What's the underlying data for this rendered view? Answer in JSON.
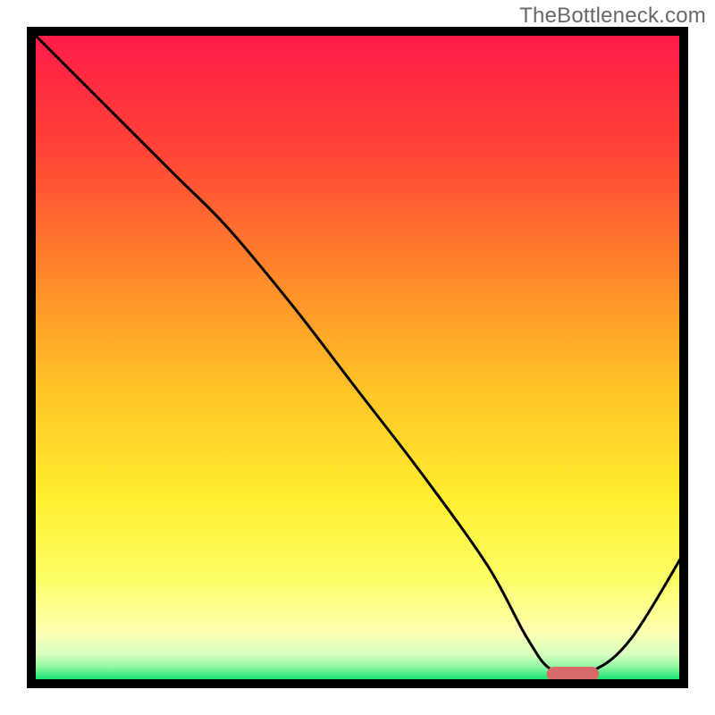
{
  "watermark": "TheBottleneck.com",
  "chart_data": {
    "type": "line",
    "title": "",
    "xlabel": "",
    "ylabel": "",
    "xlim": [
      0,
      100
    ],
    "ylim": [
      0,
      100
    ],
    "background_gradient": {
      "stops": [
        {
          "offset": 0.0,
          "color": "#ff1a4a"
        },
        {
          "offset": 0.18,
          "color": "#ff4236"
        },
        {
          "offset": 0.38,
          "color": "#ff8a2a"
        },
        {
          "offset": 0.55,
          "color": "#ffc426"
        },
        {
          "offset": 0.72,
          "color": "#ffef30"
        },
        {
          "offset": 0.84,
          "color": "#fcff66"
        },
        {
          "offset": 0.92,
          "color": "#fdffb0"
        },
        {
          "offset": 0.955,
          "color": "#d8ffc0"
        },
        {
          "offset": 0.975,
          "color": "#8cf7a0"
        },
        {
          "offset": 0.99,
          "color": "#28e67a"
        },
        {
          "offset": 1.0,
          "color": "#12db6e"
        }
      ]
    },
    "series": [
      {
        "name": "bottleneck-curve",
        "color": "#000000",
        "x": [
          0,
          10,
          22,
          30,
          40,
          50,
          60,
          70,
          76,
          80,
          86,
          92,
          100
        ],
        "y": [
          100,
          90,
          78,
          70,
          58,
          45,
          32,
          18,
          7,
          2,
          2,
          7,
          20
        ]
      }
    ],
    "marker": {
      "name": "optimal-range",
      "color": "#d86a6a",
      "x_start": 79,
      "x_end": 87,
      "y": 1.5,
      "thickness": 2.2
    },
    "axes": {
      "show_ticks": false,
      "show_grid": false,
      "frame_color": "#000000",
      "frame_width": 10
    }
  }
}
